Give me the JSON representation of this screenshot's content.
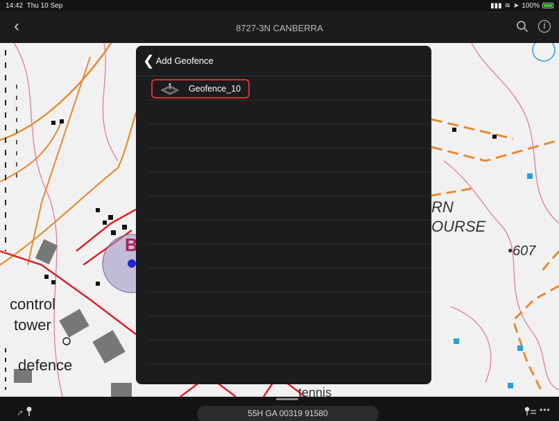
{
  "status_bar": {
    "time": "14:42",
    "date": "Thu 10 Sep",
    "battery": "100%"
  },
  "nav": {
    "title": "8727-3N CANBERRA"
  },
  "map": {
    "labels": {
      "control": "control",
      "tower": "tower",
      "defence": "defence",
      "rn": "RN",
      "ourse": "OURSE",
      "elev": "•607",
      "tennis": "tennis",
      "b": "B"
    },
    "colors": {
      "road": "#e8892e",
      "boundary": "#e02020",
      "contour": "#e07aa0"
    }
  },
  "panel": {
    "title": "Add Geofence",
    "items": [
      {
        "label": "Geofence_10",
        "icon": "geofence-icon"
      }
    ]
  },
  "bottom": {
    "coordinates": "55H GA 00319 91580"
  }
}
